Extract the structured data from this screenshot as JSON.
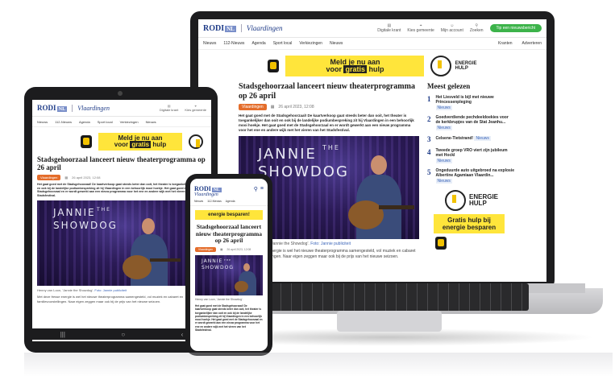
{
  "site": {
    "logo": "RODI",
    "logo_nl": "NL",
    "city": "Vlaardingen",
    "header_icons": [
      {
        "icon": "newspaper-icon",
        "label": "Digitale krant"
      },
      {
        "icon": "location-icon",
        "label": "Kies gemeente"
      },
      {
        "icon": "user-icon",
        "label": "Mijn account"
      },
      {
        "icon": "search-icon",
        "label": "Zoeken"
      }
    ],
    "cta": "Tip een nieuwsbericht",
    "nav": [
      "Nieuws",
      "112-Nieuws",
      "Agenda",
      "Sport local",
      "Verkiezingen",
      "Nieuws"
    ],
    "nav_right": [
      "Kranten",
      "Adverteren"
    ]
  },
  "banner": {
    "line1": "Meld je nu aan",
    "line2_pre": "voor",
    "line2_bold": "gratis",
    "line2_post": "hulp",
    "crest_label": "Gemeente Vlaardingen",
    "phone_text": "energie besparen!"
  },
  "article": {
    "title": "Stadsgehoorzaal lanceert nieuw theaterprogramma op 26 april",
    "tag": "Vlaardingen",
    "date": "26 april 2023, 12:08",
    "lead": "Het gaat goed met de Stadsgehoorzaal! De kaartverkoop gaat steeds beter dan ooit, het theater is toegankelijker dan ooit en ook bij de landelijke podiumbespreking zit hij Vlaardingen in een behoorlijk mooi hoekje. Het gaat goed met de Stadsgehoorzaal en er wordt gewerkt aan een nieuw programma voor het ene en andere wijk met het vieren van het Stadsfestival.",
    "body": "Met deze fresse energie is wel het nieuwe theaterprogramma samengesteld, vol muziek en cabaret en familievoorstellingen. Naar eigen zeggen maar ook bij de prijs van het nieuwe seizoen.",
    "hero_title_1": "JANNIE",
    "hero_title_2": "THE",
    "hero_title_3": "SHOWDOG",
    "caption": "Henny van Loon, 'Jannie the Showdog'.",
    "caption_link": "Foto: Jannie publiciteit"
  },
  "sidebar": {
    "title": "Meest gelezen",
    "items": [
      {
        "num": "1",
        "text": "Het Liesveld is bijl met nieuwe Princessenpleging",
        "badge": "Nieuws"
      },
      {
        "num": "2",
        "text": "Goedverdiende pechdeeldoekies voor de kerkbrupjes van de Stat Jeanhu...",
        "badge": "Nieuws"
      },
      {
        "num": "3",
        "text": "Celsene-Tietstrand!",
        "badge": "Nieuws"
      },
      {
        "num": "4",
        "text": "Tweede groep VRO viert zijn jubileum met Hockl",
        "badge": "Nieuws"
      },
      {
        "num": "5",
        "text": "Ongeduurde auto uitgebroed na explosie Albertine Agamiaan Vlaardin...",
        "badge": "Nieuws"
      }
    ],
    "energie_line1": "ENERGIE",
    "energie_line2": "HULP",
    "gratis_line1": "Gratis hulp bij",
    "gratis_line2": "energie besparen"
  },
  "colors": {
    "brand_blue": "#1f3c88",
    "banner_yellow": "#ffe53b",
    "tag_orange": "#e46d2b",
    "cta_green": "#3cb34a"
  }
}
